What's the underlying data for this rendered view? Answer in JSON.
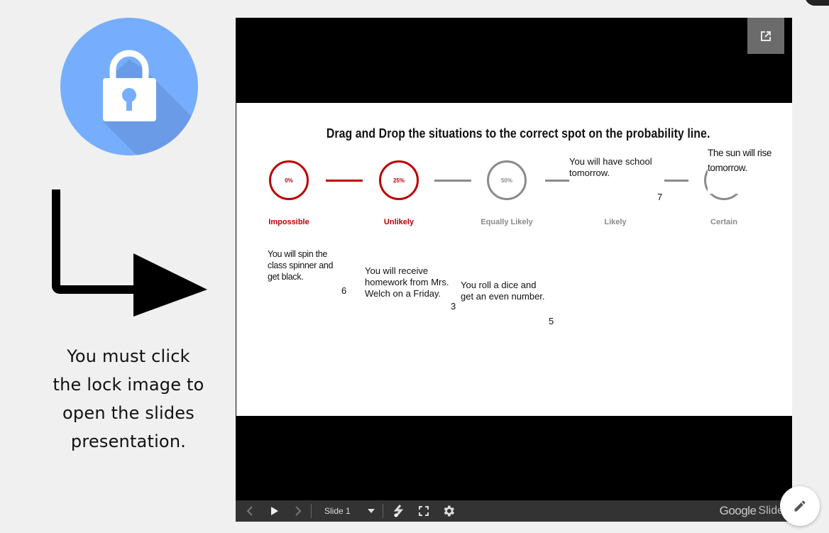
{
  "sidebar": {
    "lock_image_alt": "lock",
    "instructions_lines": [
      "You must click",
      "the lock image to",
      "open the slides",
      "presentation."
    ],
    "colors": {
      "lock_bg": "#76aefd",
      "lock_shadow": "#6a9be6"
    }
  },
  "slide": {
    "title": "Drag and Drop the situations to the correct spot on the probability line.",
    "probability_line": [
      {
        "percent": "0%",
        "label": "Impossible",
        "color": "#b00000"
      },
      {
        "percent": "25%",
        "label": "Unlikely",
        "color": "#b00000"
      },
      {
        "percent": "50%",
        "label": "Equally Likely",
        "color": "#8a8a8a"
      },
      {
        "percent": "",
        "label": "Likely",
        "color": "#8a8a8a"
      },
      {
        "percent": "",
        "label": "Certain",
        "color": "#8a8a8a"
      }
    ],
    "cards": [
      {
        "lines": [
          "You will have school",
          "tomorrow."
        ],
        "number": "7"
      },
      {
        "lines": [
          "The sun will rise",
          "tomorrow."
        ],
        "number": ""
      },
      {
        "lines": [
          "You will spin the",
          "class spinner and",
          "get black."
        ],
        "number": "6"
      },
      {
        "lines": [
          "You will receive",
          "homework from Mrs.",
          "Welch on a Friday."
        ],
        "number": "3"
      },
      {
        "lines": [
          "You roll a dice and",
          "get an even number."
        ],
        "number": "5"
      }
    ]
  },
  "toolbar": {
    "slide_label": "Slide 1",
    "brand_google": "Google",
    "brand_slides": "Slides"
  }
}
